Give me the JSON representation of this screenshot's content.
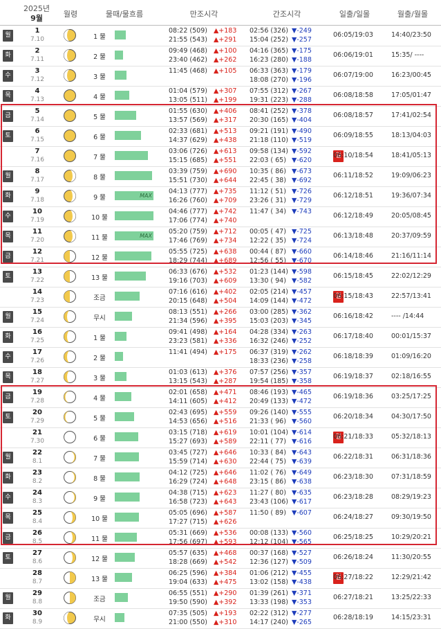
{
  "header": {
    "year": "2025년",
    "month": "9월",
    "moon": "월령",
    "tide": "물때/물흐름",
    "high": "만조시각",
    "low": "간조시각",
    "sun": "일출/일몰",
    "moonrise": "월출/월몰"
  },
  "rows": [
    {
      "wd": "월",
      "day": "1",
      "lunar": "7.10",
      "moon": "waxing-large",
      "tide": "1 물",
      "bar": 0.28,
      "max": "",
      "h1a": "08:22 (509)",
      "h1b": "▲+183",
      "h2a": "21:55 (543)",
      "h2b": "▲+291",
      "l1a": "02:56 (326)",
      "l1b": "▼-249",
      "l2a": "15:04 (252)",
      "l2b": "▼-257",
      "sun": "06:05/19:03",
      "mr": "14:40/23:50"
    },
    {
      "wd": "화",
      "day": "2",
      "lunar": "7.11",
      "moon": "waxing-large",
      "tide": "2 물",
      "bar": 0.22,
      "max": "",
      "h1a": "09:49 (468)",
      "h1b": "▲+100",
      "h2a": "23:40 (462)",
      "h2b": "▲+262",
      "l1a": "04:16 (365)",
      "l1b": "▼-175",
      "l2a": "16:23 (280)",
      "l2b": "▼-188",
      "sun": "06:06/19:01",
      "mr": "15:35/ ----"
    },
    {
      "wd": "수",
      "day": "3",
      "lunar": "7.12",
      "moon": "waxing-large",
      "tide": "3 물",
      "bar": 0.3,
      "max": "",
      "h1a": "11:45 (468)",
      "h1b": "▲+105",
      "h2a": "",
      "h2b": "",
      "l1a": "06:33 (363)",
      "l1b": "▼-179",
      "l2a": "18:08 (270)",
      "l2b": "▼-196",
      "sun": "06:07/19:00",
      "mr": "16:23/00:45"
    },
    {
      "wd": "목",
      "day": "4",
      "lunar": "7.13",
      "moon": "full",
      "tide": "4 물",
      "bar": 0.38,
      "max": "",
      "h1a": "01:04 (579)",
      "h1b": "▲+307",
      "h2a": "13:05 (511)",
      "h2b": "▲+199",
      "l1a": "07:55 (312)",
      "l1b": "▼-267",
      "l2a": "19:31 (223)",
      "l2b": "▼-288",
      "sun": "06:08/18:58",
      "mr": "17:05/01:47"
    },
    {
      "wd": "금",
      "day": "5",
      "lunar": "7.14",
      "moon": "full",
      "tide": "5 물",
      "bar": 0.55,
      "max": "",
      "h1a": "01:55 (630)",
      "h1b": "▲+406",
      "h2a": "13:57 (569)",
      "h2b": "▲+317",
      "l1a": "08:41 (252)",
      "l1b": "▼-378",
      "l2a": "20:30 (165)",
      "l2b": "▼-404",
      "sun": "06:08/18:57",
      "mr": "17:41/02:54"
    },
    {
      "wd": "토",
      "day": "6",
      "lunar": "7.15",
      "moon": "full",
      "tide": "6 물",
      "bar": 0.68,
      "max": "",
      "h1a": "02:33 (681)",
      "h1b": "▲+513",
      "h2a": "14:37 (629)",
      "h2b": "▲+438",
      "l1a": "09:21 (191)",
      "l1b": "▼-490",
      "l2a": "21:18 (110)",
      "l2b": "▼-519",
      "sun": "06:09/18:55",
      "mr": "18:13/04:03"
    },
    {
      "wd": "일",
      "day": "7",
      "lunar": "7.16",
      "moon": "full",
      "tide": "7 물",
      "bar": 0.85,
      "max": "",
      "h1a": "03:06 (726)",
      "h1b": "▲+613",
      "h2a": "15:15 (685)",
      "h2b": "▲+551",
      "l1a": "09:58 (134)",
      "l1b": "▼-592",
      "l2a": "22:03 ( 65)",
      "l2b": "▼-620",
      "sun": "06:10/18:54",
      "mr": "18:41/05:13"
    },
    {
      "wd": "월",
      "day": "8",
      "lunar": "7.17",
      "moon": "waning-large",
      "tide": "8 물",
      "bar": 0.97,
      "max": "",
      "h1a": "03:39 (759)",
      "h1b": "▲+690",
      "h2a": "15:51 (730)",
      "h2b": "▲+644",
      "l1a": "10:35 ( 86)",
      "l1b": "▼-673",
      "l2a": "22:45 ( 38)",
      "l2b": "▼-692",
      "sun": "06:11/18:52",
      "mr": "19:09/06:23"
    },
    {
      "wd": "화",
      "day": "9",
      "lunar": "7.18",
      "moon": "waning-large",
      "tide": "9 물",
      "bar": 1.0,
      "max": "MAX",
      "h1a": "04:13 (777)",
      "h1b": "▲+735",
      "h2a": "16:26 (760)",
      "h2b": "▲+709",
      "l1a": "11:12 ( 51)",
      "l1b": "▼-726",
      "l2a": "23:26 ( 31)",
      "l2b": "▼-729",
      "sun": "06:12/18:51",
      "mr": "19:36/07:34"
    },
    {
      "wd": "수",
      "day": "10",
      "lunar": "7.19",
      "moon": "waning-large",
      "tide": "10 물",
      "bar": 1.0,
      "max": "",
      "h1a": "04:46 (777)",
      "h1b": "▲+742",
      "h2a": "17:06 (774)",
      "h2b": "▲+740",
      "l1a": "11:47 ( 34)",
      "l1b": "▼-743",
      "l2a": "",
      "l2b": "",
      "sun": "06:12/18:49",
      "mr": "20:05/08:45"
    },
    {
      "wd": "목",
      "day": "11",
      "lunar": "7.20",
      "moon": "waning-large",
      "tide": "11 물",
      "bar": 1.0,
      "max": "MAX",
      "h1a": "05:20 (759)",
      "h1b": "▲+712",
      "h2a": "17:46 (769)",
      "h2b": "▲+734",
      "l1a": "00:05 ( 47)",
      "l1b": "▼-725",
      "l2a": "12:22 ( 35)",
      "l2b": "▼-724",
      "sun": "06:13/18:48",
      "mr": "20:37/09:59"
    },
    {
      "wd": "금",
      "day": "12",
      "lunar": "7.21",
      "moon": "half-waning",
      "tide": "12 물",
      "bar": 0.95,
      "max": "",
      "h1a": "05:55 (725)",
      "h1b": "▲+638",
      "h2a": "18:29 (744)",
      "h2b": "▲+689",
      "l1a": "00:44 ( 87)",
      "l1b": "▼-660",
      "l2a": "12:56 ( 55)",
      "l2b": "▼-670",
      "sun": "06:14/18:46",
      "mr": "21:16/11:14"
    },
    {
      "wd": "토",
      "day": "13",
      "lunar": "7.22",
      "moon": "half-waning",
      "tide": "13 물",
      "bar": 0.8,
      "max": "",
      "h1a": "06:33 (676)",
      "h1b": "▲+532",
      "h2a": "19:16 (703)",
      "h2b": "▲+609",
      "l1a": "01:23 (144)",
      "l1b": "▼-598",
      "l2a": "13:30 ( 94)",
      "l2b": "▼-582",
      "sun": "06:15/18:45",
      "mr": "22:02/12:29"
    },
    {
      "wd": "일",
      "day": "14",
      "lunar": "7.23",
      "moon": "half-waning",
      "tide": "조금",
      "bar": 0.65,
      "max": "",
      "h1a": "07:16 (616)",
      "h1b": "▲+402",
      "h2a": "20:15 (648)",
      "h2b": "▲+504",
      "l1a": "02:05 (214)",
      "l1b": "▼-457",
      "l2a": "14:09 (144)",
      "l2b": "▼-472",
      "sun": "06:15/18:43",
      "mr": "22:57/13:41"
    },
    {
      "wd": "월",
      "day": "15",
      "lunar": "7.24",
      "moon": "crescent-waning",
      "tide": "무시",
      "bar": 0.45,
      "max": "",
      "h1a": "08:13 (551)",
      "h1b": "▲+266",
      "h2a": "21:34 (596)",
      "h2b": "▲+395",
      "l1a": "03:00 (285)",
      "l1b": "▼-362",
      "l2a": "15:03 (203)",
      "l2b": "▼-345",
      "sun": "06:16/18:42",
      "mr": "---- /14:44"
    },
    {
      "wd": "화",
      "day": "16",
      "lunar": "7.25",
      "moon": "crescent-waning",
      "tide": "1 물",
      "bar": 0.3,
      "max": "",
      "h1a": "09:41 (498)",
      "h1b": "▲+164",
      "h2a": "23:23 (581)",
      "h2b": "▲+336",
      "l1a": "04:28 (334)",
      "l1b": "▼-263",
      "l2a": "16:32 (246)",
      "l2b": "▼-252",
      "sun": "06:17/18:40",
      "mr": "00:01/15:37"
    },
    {
      "wd": "수",
      "day": "17",
      "lunar": "7.26",
      "moon": "crescent-waning",
      "tide": "2 물",
      "bar": 0.22,
      "max": "",
      "h1a": "11:41 (494)",
      "h1b": "▲+175",
      "h2a": "",
      "h2b": "",
      "l1a": "06:37 (319)",
      "l1b": "▼-262",
      "l2a": "18:33 (236)",
      "l2b": "▼-258",
      "sun": "06:18/18:39",
      "mr": "01:09/16:20"
    },
    {
      "wd": "목",
      "day": "18",
      "lunar": "7.27",
      "moon": "crescent-waning",
      "tide": "3 물",
      "bar": 0.3,
      "max": "",
      "h1a": "01:03 (613)",
      "h1b": "▲+376",
      "h2a": "13:15 (543)",
      "h2b": "▲+287",
      "l1a": "07:57 (256)",
      "l1b": "▼-357",
      "l2a": "19:54 (185)",
      "l2b": "▼-358",
      "sun": "06:19/18:37",
      "mr": "02:18/16:55"
    },
    {
      "wd": "금",
      "day": "19",
      "lunar": "7.28",
      "moon": "thin-waning",
      "tide": "4 물",
      "bar": 0.42,
      "max": "",
      "h1a": "02:01 (658)",
      "h1b": "▲+471",
      "h2a": "14:11 (605)",
      "h2b": "▲+412",
      "l1a": "08:46 (193)",
      "l1b": "▼-465",
      "l2a": "20:49 (133)",
      "l2b": "▼-472",
      "sun": "06:19/18:36",
      "mr": "03:25/17:25"
    },
    {
      "wd": "토",
      "day": "20",
      "lunar": "7.29",
      "moon": "thin-waning",
      "tide": "5 물",
      "bar": 0.5,
      "max": "",
      "h1a": "02:43 (695)",
      "h1b": "▲+559",
      "h2a": "14:53 (656)",
      "h2b": "▲+516",
      "l1a": "09:26 (140)",
      "l1b": "▼-555",
      "l2a": "21:33 ( 96)",
      "l2b": "▼-560",
      "sun": "06:20/18:34",
      "mr": "04:30/17:50"
    },
    {
      "wd": "일",
      "day": "21",
      "lunar": "7.30",
      "moon": "new",
      "tide": "6 물",
      "bar": 0.6,
      "max": "",
      "h1a": "03:15 (718)",
      "h1b": "▲+619",
      "h2a": "15:27 (693)",
      "h2b": "▲+589",
      "l1a": "10:01 (104)",
      "l1b": "▼-614",
      "l2a": "22:11 ( 77)",
      "l2b": "▼-616",
      "sun": "06:21/18:33",
      "mr": "05:32/18:13"
    },
    {
      "wd": "월",
      "day": "22",
      "lunar": "8.1",
      "moon": "thin-waxing",
      "tide": "7 물",
      "bar": 0.62,
      "max": "",
      "h1a": "03:45 (727)",
      "h1b": "▲+646",
      "h2a": "15:59 (714)",
      "h2b": "▲+630",
      "l1a": "10:33 ( 84)",
      "l1b": "▼-643",
      "l2a": "22:44 ( 75)",
      "l2b": "▼-639",
      "sun": "06:22/18:31",
      "mr": "06:31/18:36"
    },
    {
      "wd": "화",
      "day": "23",
      "lunar": "8.2",
      "moon": "thin-waxing",
      "tide": "8 물",
      "bar": 0.65,
      "max": "",
      "h1a": "04:12 (725)",
      "h1b": "▲+646",
      "h2a": "16:29 (724)",
      "h2b": "▲+648",
      "l1a": "11:02 ( 76)",
      "l1b": "▼-649",
      "l2a": "23:15 ( 86)",
      "l2b": "▼-638",
      "sun": "06:23/18:30",
      "mr": "07:31/18:59"
    },
    {
      "wd": "수",
      "day": "24",
      "lunar": "8.3",
      "moon": "thin-waxing",
      "tide": "9 물",
      "bar": 0.64,
      "max": "",
      "h1a": "04:38 (715)",
      "h1b": "▲+623",
      "h2a": "16:58 (723)",
      "h2b": "▲+643",
      "l1a": "11:27 ( 80)",
      "l1b": "▼-635",
      "l2a": "23:43 (106)",
      "l2b": "▼-617",
      "sun": "06:23/18:28",
      "mr": "08:29/19:23"
    },
    {
      "wd": "목",
      "day": "25",
      "lunar": "8.4",
      "moon": "crescent-waxing",
      "tide": "10 물",
      "bar": 0.62,
      "max": "",
      "h1a": "05:05 (696)",
      "h1b": "▲+587",
      "h2a": "17:27 (715)",
      "h2b": "▲+626",
      "l1a": "11:50 ( 89)",
      "l1b": "▼-607",
      "l2a": "",
      "l2b": "",
      "sun": "06:24/18:27",
      "mr": "09:30/19:50"
    },
    {
      "wd": "금",
      "day": "26",
      "lunar": "8.5",
      "moon": "crescent-waxing",
      "tide": "11 물",
      "bar": 0.58,
      "max": "",
      "h1a": "05:31 (669)",
      "h1b": "▲+536",
      "h2a": "17:56 (697)",
      "h2b": "▲+593",
      "l1a": "00:08 (133)",
      "l1b": "▼-560",
      "l2a": "12:12 (104)",
      "l2b": "▼-565",
      "sun": "06:25/18:25",
      "mr": "10:29/20:21"
    },
    {
      "wd": "토",
      "day": "27",
      "lunar": "8.6",
      "moon": "crescent-waxing",
      "tide": "12 물",
      "bar": 0.52,
      "max": "",
      "h1a": "05:57 (635)",
      "h1b": "▲+468",
      "h2a": "18:28 (669)",
      "h2b": "▲+542",
      "l1a": "00:37 (168)",
      "l1b": "▼-527",
      "l2a": "12:36 (127)",
      "l2b": "▼-509",
      "sun": "06:26/18:24",
      "mr": "11:30/20:55"
    },
    {
      "wd": "일",
      "day": "28",
      "lunar": "8.7",
      "moon": "half-waxing",
      "tide": "13 물",
      "bar": 0.44,
      "max": "",
      "h1a": "06:25 (596)",
      "h1b": "▲+384",
      "h2a": "19:04 (633)",
      "h2b": "▲+475",
      "l1a": "01:06 (212)",
      "l1b": "▼-455",
      "l2a": "13:02 (158)",
      "l2b": "▼-438",
      "sun": "06:27/18:22",
      "mr": "12:29/21:42"
    },
    {
      "wd": "월",
      "day": "29",
      "lunar": "8.8",
      "moon": "half-waxing",
      "tide": "조금",
      "bar": 0.34,
      "max": "",
      "h1a": "06:55 (551)",
      "h1b": "▲+290",
      "h2a": "19:50 (590)",
      "h2b": "▲+392",
      "l1a": "01:39 (261)",
      "l1b": "▼-371",
      "l2a": "13:33 (198)",
      "l2b": "▼-353",
      "sun": "06:27/18:21",
      "mr": "13:25/22:33"
    },
    {
      "wd": "화",
      "day": "30",
      "lunar": "8.9",
      "moon": "waxing-large",
      "tide": "무시",
      "bar": 0.25,
      "max": "",
      "h1a": "07:35 (505)",
      "h1b": "▲+193",
      "h2a": "21:00 (550)",
      "h2b": "▲+310",
      "l1a": "02:22 (312)",
      "l1b": "▼-277",
      "l2a": "14:17 (240)",
      "l2b": "▼-265",
      "sun": "06:28/18:19",
      "mr": "14:15/23:31"
    }
  ]
}
